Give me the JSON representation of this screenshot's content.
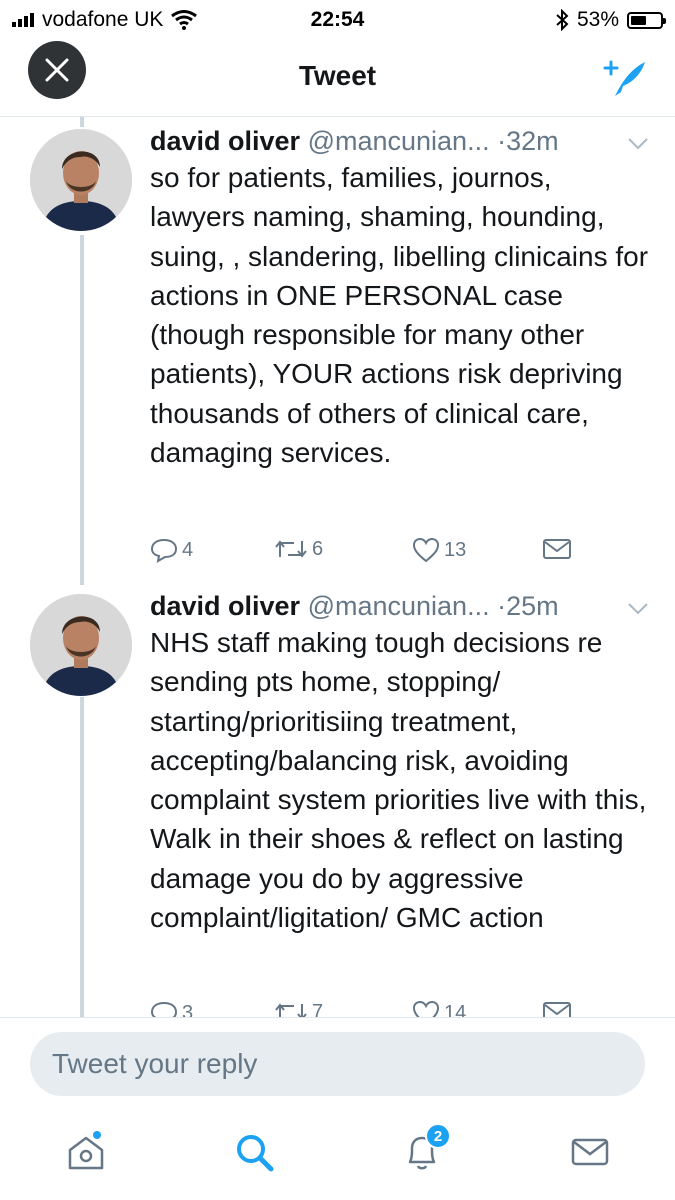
{
  "status_bar": {
    "carrier": "vodafone UK",
    "time": "22:54",
    "battery_percent": "53%",
    "battery_level": 0.53
  },
  "nav": {
    "title": "Tweet",
    "close_icon": "close-icon",
    "compose_icon": "compose-tweet-icon"
  },
  "tweets": [
    {
      "author": "david oliver",
      "handle": "@mancunian...",
      "time": "·32m",
      "text": "so for patients, families, journos, lawyers naming, shaming, hounding, suing, , slandering, libelling clinicains for actions in ONE PERSONAL case (though responsible for many other patients), YOUR actions risk depriving thousands of others of clinical care, damaging services.",
      "replies": "4",
      "retweets": "6",
      "likes": "13"
    },
    {
      "author": "david oliver",
      "handle": "@mancunian...",
      "time": "·25m",
      "text": "NHS staff making tough decisions re sending pts home,  stopping/ starting/prioritisiing treatment, accepting/balancing risk, avoiding complaint system  priorities live with this, Walk in their shoes & reflect on lasting damage you do by aggressive complaint/ligitation/ GMC action",
      "replies": "3",
      "retweets": "7",
      "likes": "14"
    }
  ],
  "reply": {
    "placeholder": "Tweet your reply"
  },
  "tab_bar": {
    "notifications_badge": "2",
    "icons": [
      "home-icon",
      "search-icon",
      "notifications-icon",
      "messages-icon"
    ]
  },
  "colors": {
    "accent": "#1da1f2",
    "text": "#14171a",
    "muted": "#657786",
    "thread_line": "#ccd6dd"
  }
}
